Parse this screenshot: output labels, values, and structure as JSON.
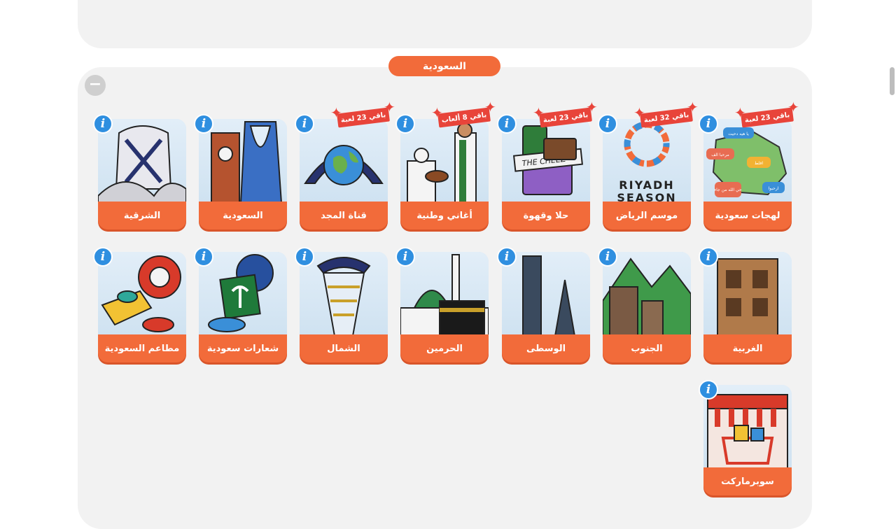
{
  "section": {
    "title": "السعودية",
    "collapse_label": "−"
  },
  "colors": {
    "accent": "#f26b3a",
    "badge": "#e8443a",
    "info": "#2f8fe0",
    "panel": "#f2f2f2"
  },
  "cards": [
    {
      "label": "لهجات سعودية",
      "badge": "باقي 23 لعبة"
    },
    {
      "label": "موسم الرياض",
      "badge": "باقي 32 لعبة",
      "art_text": [
        "RIYADH",
        "SEASON"
      ]
    },
    {
      "label": "حلا وقهوة",
      "badge": "باقي 23 لعبة",
      "art_text": [
        "THE CHEEZ"
      ]
    },
    {
      "label": "أغاني وطنية",
      "badge": "باقي 8 ألعاب"
    },
    {
      "label": "قناة المجد",
      "badge": "باقي 23 لعبة"
    },
    {
      "label": "السعودية",
      "badge": null
    },
    {
      "label": "الشرقية",
      "badge": null
    },
    {
      "label": "الغربية",
      "badge": null
    },
    {
      "label": "الجنوب",
      "badge": null
    },
    {
      "label": "الوسطى",
      "badge": null
    },
    {
      "label": "الحرمين",
      "badge": null
    },
    {
      "label": "الشمال",
      "badge": null
    },
    {
      "label": "شعارات سعودية",
      "badge": null
    },
    {
      "label": "مطاعم السعودية",
      "badge": null
    },
    {
      "label": "سوبرماركت",
      "badge": null
    }
  ],
  "dialect_bubbles": [
    "يا هيه دحيت",
    "مرحبا الف",
    "اقلط",
    "حي الله من جاء",
    "ارحبوا"
  ]
}
